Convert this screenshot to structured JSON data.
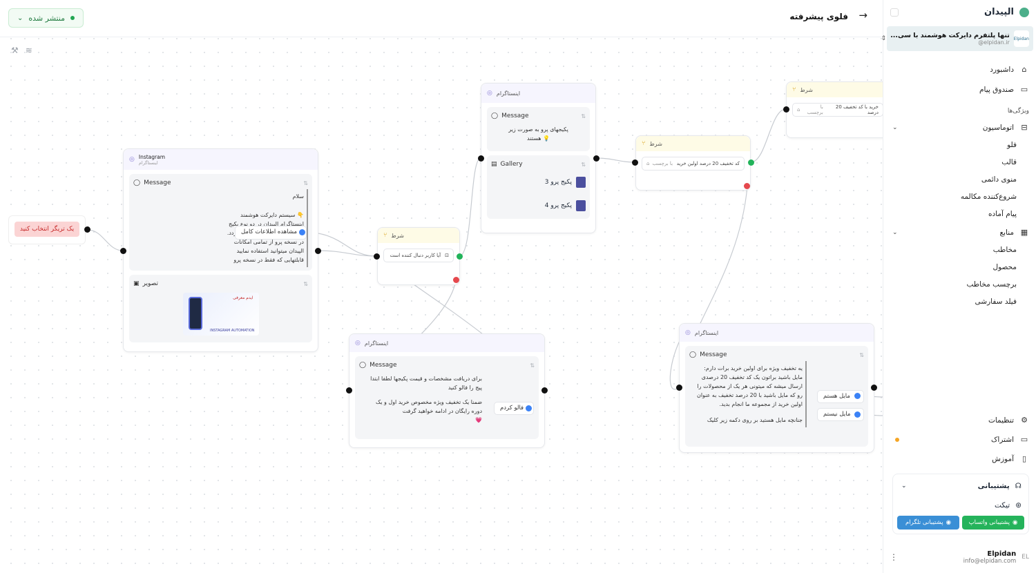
{
  "topbar": {
    "status": "منتشر شده",
    "title": "فلوی پیشرفته"
  },
  "trigger": {
    "label": "یک تریگر انتخاب کنید"
  },
  "node_instagram1": {
    "title": "Instagram",
    "subtitle": "اینستاگرام",
    "message_label": "Message",
    "message_text": [
      "سلام",
      "👇 سیستم دایرکت هوشمند",
      "اینستاگرام الپیدان در دو نوع پکیج",
      "استاندارد و پکیج پرو ارائه میگردد.",
      "در نسخه پرو از تمامی امکانات",
      "الپیدان میتوانید استفاده نمایید",
      "قابلتهایی که فقط در نسخه پرو"
    ],
    "button": "مشاهده اطلاعات کامل",
    "image_label": "تصویر",
    "image_title": "ایدم معرفی",
    "image_caption": "INSTAGRAM AUTOMATION"
  },
  "node_cond1": {
    "title": "شرط",
    "condition": "آیا کاربر دنبال کننده است"
  },
  "node_instagram2": {
    "title": "اینستاگرام",
    "message_label": "Message",
    "message_text": [
      "پکیجهای پرو به صورت زیر",
      "💡 هستند"
    ],
    "gallery_label": "Gallery",
    "gallery_items": [
      "پکیج پرو 3",
      "پکیج پرو 4"
    ]
  },
  "node_cond2": {
    "title": "شرط",
    "condition": "کد تخفیف 20 درصد اولین خرید",
    "tag": "با برچسب"
  },
  "node_cond3": {
    "title": "شرط",
    "condition": "خرید با کد تخفیف 20 درصد",
    "tag": "با برچسب"
  },
  "node_instagram3": {
    "title": "اینستاگرام",
    "message_label": "Message",
    "message_text": [
      "برای دریافت مشخصات و قیمت پکیجها لطفا ابتدا",
      "پیج را فالو کنید",
      "",
      "ضمنا یک تخفیف ویژه مخصوص خرید اول و یک",
      "دوره رایگان در ادامه خواهید گرفت",
      "💗"
    ],
    "button": "فالو کردم"
  },
  "node_instagram4": {
    "title": "اینستاگرام",
    "message_label": "Message",
    "message_text": [
      "یه تخفیف ویژه برای اولین خرید برات دارم:",
      "مایل باشید براتون یک کد تخفیف 20 درصدی",
      "ارسال میشه که میتونی هر یک از محصولات را",
      "رو که مایل باشید با 20 درصد تخفیف به عنوان",
      "اولین خرید از مجموعه ما انجام بدید.",
      "",
      "جنانچه مایل هستید بر روی دکمه زیر کلیک"
    ],
    "buttons": [
      "مایل هستم",
      "مایل نیستم"
    ]
  },
  "sidebar": {
    "brand": "الپیدان",
    "workspace_name": "تنها پلتفرم دایرکت هوشمند با سی...",
    "workspace_handle": "@elpidan.ir",
    "workspace_logo": "Elpidan",
    "nav_top": [
      {
        "label": "داشبورد",
        "icon": "home-icon"
      },
      {
        "label": "صندوق پیام",
        "icon": "inbox-icon"
      }
    ],
    "features_label": "ویژگی‌ها",
    "automation": {
      "label": "اتوماسیون",
      "items": [
        "فلو",
        "قالب",
        "منوی دائمی",
        "شروع‌کننده مکالمه",
        "پیام آماده"
      ]
    },
    "resources": {
      "label": "منابع",
      "items": [
        "مخاطب",
        "محصول",
        "برچسب مخاطب",
        "فیلد سفارشی"
      ]
    },
    "nav_bottom": [
      {
        "label": "تنظیمات",
        "icon": "gear-icon"
      },
      {
        "label": "اشتراک",
        "icon": "card-icon"
      },
      {
        "label": "آموزش",
        "icon": "book-icon"
      }
    ],
    "support": {
      "label": "پشتیبانی",
      "ticket": "تیکت",
      "whatsapp": "پشتیبانی واتساپ",
      "telegram": "پشتیبانی تلگرام"
    },
    "user": {
      "name": "Elpidan",
      "email": "info@elpidan.com",
      "avatar": "EL"
    }
  },
  "colors": {
    "accent": "#22a652",
    "condition_head": "#fefbe6",
    "message_head": "#f6f5fe",
    "trigger_bg": "#fbd4d4"
  }
}
